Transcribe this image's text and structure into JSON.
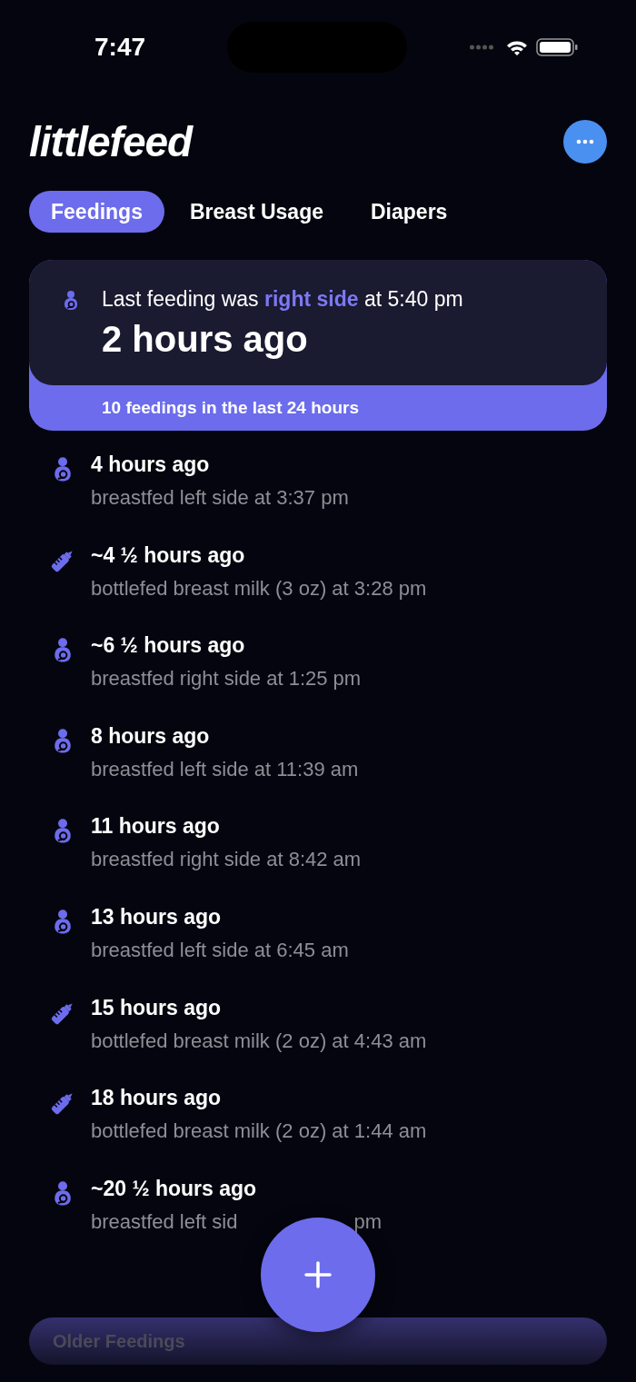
{
  "status_bar": {
    "time": "7:47"
  },
  "header": {
    "logo": "littlefeed"
  },
  "tabs": [
    {
      "label": "Feedings",
      "selected": true
    },
    {
      "label": "Breast Usage",
      "selected": false
    },
    {
      "label": "Diapers",
      "selected": false
    }
  ],
  "last_feeding": {
    "kind": "breast",
    "summary": "Last feeding was **right side** at 5:40 pm",
    "elapsed": "2 hours ago",
    "footer": "10 feedings in the last 24 hours"
  },
  "feedings": [
    {
      "kind": "breast",
      "elapsed": "4 hours ago",
      "detail": [
        "breastfed left side at 3:37 pm"
      ]
    },
    {
      "kind": "bottle",
      "elapsed": "~4 ½ hours ago",
      "detail": [
        "bottlefed breast milk (3 oz) at 3:28 pm"
      ]
    },
    {
      "kind": "breast",
      "elapsed": "~6 ½ hours ago",
      "detail": [
        "breastfed right side at 1:25 pm"
      ]
    },
    {
      "kind": "breast",
      "elapsed": "8 hours ago",
      "detail": [
        "breastfed left side at 11:39 am"
      ]
    },
    {
      "kind": "breast",
      "elapsed": "11 hours ago",
      "detail": [
        "breastfed right side at 8:42 am"
      ]
    },
    {
      "kind": "breast",
      "elapsed": "13 hours ago",
      "detail": [
        "breastfed left side at 6:45 am"
      ]
    },
    {
      "kind": "bottle",
      "elapsed": "15 hours ago",
      "detail": [
        "bottlefed breast milk (2 oz) at 4:43 am"
      ]
    },
    {
      "kind": "bottle",
      "elapsed": "18 hours ago",
      "detail": [
        "bottlefed breast milk (2 oz) at 1:44 am"
      ]
    },
    {
      "kind": "breast",
      "elapsed": "~20 ½ hours ago",
      "detail": [
        "breastfed left sid",
        "pm"
      ]
    }
  ],
  "older_button": {
    "label": "Older Feedings"
  }
}
